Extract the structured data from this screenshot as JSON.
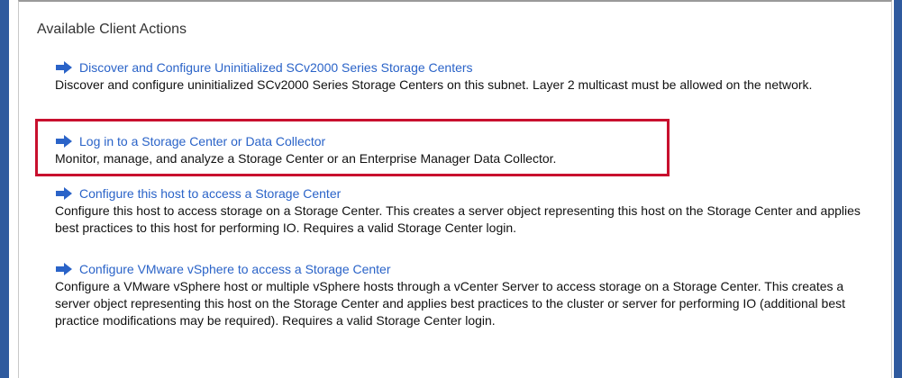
{
  "panel": {
    "title": "Available Client Actions"
  },
  "actions": [
    {
      "link": "Discover and Configure Uninitialized SCv2000 Series Storage Centers",
      "description": "Discover and configure uninitialized SCv2000 Series Storage Centers on this subnet. Layer 2 multicast must be allowed on the network."
    },
    {
      "link": "Log in to a Storage Center or Data Collector",
      "description": "Monitor, manage, and analyze a Storage Center or an Enterprise Manager Data Collector."
    },
    {
      "link": "Configure this host to access a Storage Center",
      "description": "Configure this host to access storage on a Storage Center. This creates a server object representing this host on the Storage Center and applies best practices to this host for performing IO. Requires a valid Storage Center login."
    },
    {
      "link": "Configure VMware vSphere to access a Storage Center",
      "description": "Configure a VMware vSphere host or multiple vSphere hosts through a vCenter Server to access storage on a Storage Center. This creates a server object representing this host on the Storage Center and applies best practices to the cluster or server for performing IO (additional best practice modifications may be required). Requires a valid Storage Center login."
    }
  ],
  "icons": {
    "action_arrow": "arrow-right-icon"
  },
  "colors": {
    "link": "#2a63c8",
    "highlight_border": "#c8102e",
    "side_bar": "#2f5a9e"
  }
}
